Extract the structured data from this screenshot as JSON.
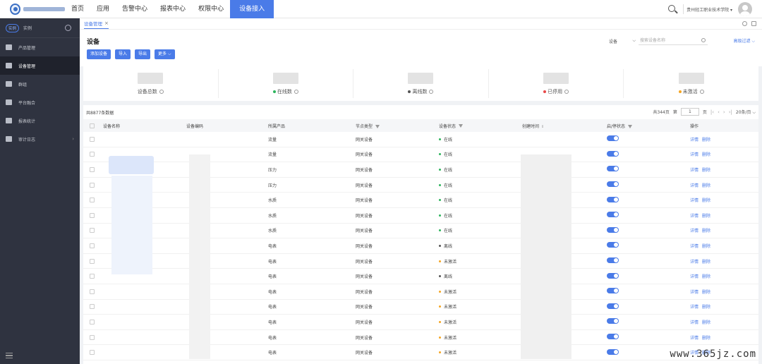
{
  "nav": {
    "items": [
      "首页",
      "应用",
      "告警中心",
      "报表中心",
      "权限中心",
      "设备接入"
    ],
    "active_index": 5
  },
  "top_right": {
    "org": "贵州轻工职业技术学院 ▾"
  },
  "sidebar": {
    "tag": "实例",
    "instance": "实例",
    "items": [
      {
        "label": "产品管理",
        "icon": "grid-icon"
      },
      {
        "label": "设备管理",
        "icon": "device-icon",
        "active": true
      },
      {
        "label": "群组",
        "icon": "group-icon"
      },
      {
        "label": "平台融合",
        "icon": "link-icon"
      },
      {
        "label": "报表统计",
        "icon": "report-icon"
      },
      {
        "label": "审计日志",
        "icon": "log-icon",
        "arrow": "›"
      }
    ]
  },
  "tabs": [
    {
      "label": "设备管理",
      "close": "×"
    }
  ],
  "page": {
    "title": "设备"
  },
  "toolbar": {
    "add": "添加设备",
    "import": "导入",
    "export": "导出",
    "more": "更多 ⌵"
  },
  "search": {
    "select": "设备",
    "select_arrow": "⌵",
    "placeholder": "搜索设备名称",
    "filter": "高级过滤 ⌵"
  },
  "stats": [
    {
      "label": "设备总数",
      "dot": ""
    },
    {
      "label": "在线数",
      "dot": "#2db55d"
    },
    {
      "label": "离线数",
      "dot": "#555555"
    },
    {
      "label": "已停用",
      "dot": "#e84a4a"
    },
    {
      "label": "未激活",
      "dot": "#f5a623"
    }
  ],
  "table": {
    "total": "共8877条数据",
    "pager": {
      "pages": "共344页",
      "go": "第",
      "page": "1",
      "unit": "页",
      "first": "|‹",
      "prev": "‹",
      "next": "›",
      "last": "›|",
      "size": "20条/页 ⌵"
    },
    "headers": [
      "设备名称",
      "设备编码",
      "所属产品",
      "节点类型",
      "设备状态",
      "创建时间",
      "启/停状态",
      "操作"
    ],
    "rows": [
      {
        "product": "流量",
        "type": "网关设备",
        "status": "在线",
        "status_color": "#2db55d"
      },
      {
        "product": "流量",
        "type": "网关设备",
        "status": "在线",
        "status_color": "#2db55d"
      },
      {
        "product": "压力",
        "type": "网关设备",
        "status": "在线",
        "status_color": "#2db55d"
      },
      {
        "product": "压力",
        "type": "网关设备",
        "status": "在线",
        "status_color": "#2db55d"
      },
      {
        "product": "水质",
        "type": "网关设备",
        "status": "在线",
        "status_color": "#2db55d"
      },
      {
        "product": "水质",
        "type": "网关设备",
        "status": "在线",
        "status_color": "#2db55d"
      },
      {
        "product": "水质",
        "type": "网关设备",
        "status": "在线",
        "status_color": "#2db55d"
      },
      {
        "product": "电表",
        "type": "网关设备",
        "status": "离线",
        "status_color": "#555555"
      },
      {
        "product": "电表",
        "type": "网关设备",
        "status": "未激活",
        "status_color": "#f5a623"
      },
      {
        "product": "电表",
        "type": "网关设备",
        "status": "离线",
        "status_color": "#555555"
      },
      {
        "product": "电表",
        "type": "网关设备",
        "status": "未激活",
        "status_color": "#f5a623"
      },
      {
        "product": "电表",
        "type": "网关设备",
        "status": "未激活",
        "status_color": "#f5a623"
      },
      {
        "product": "电表",
        "type": "网关设备",
        "status": "未激活",
        "status_color": "#f5a623"
      },
      {
        "product": "电表",
        "type": "网关设备",
        "status": "未激活",
        "status_color": "#f5a623"
      },
      {
        "product": "电表",
        "type": "网关设备",
        "status": "未激活",
        "status_color": "#f5a623"
      }
    ],
    "actions": {
      "detail": "详情",
      "delete": "删除"
    }
  },
  "watermark": "www.365jz.com",
  "colors": {
    "accent": "#4a7be8",
    "sidebar": "#2f3340"
  }
}
